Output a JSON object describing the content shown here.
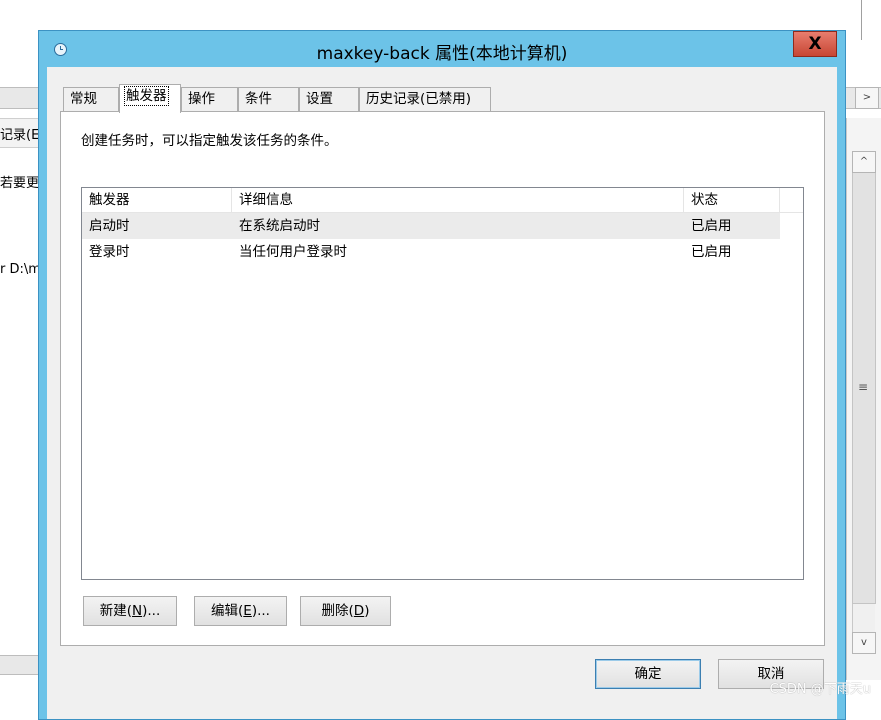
{
  "background": {
    "fragments": [
      "记录(E",
      "若要更",
      "r D:\\m"
    ],
    "scroll_right_label": ">",
    "scroll_up": "^",
    "scroll_down": "v",
    "scroll_grip": "≡"
  },
  "dialog": {
    "title": "maxkey-back 属性(本地计算机)",
    "close_label": "X",
    "tabs": [
      "常规",
      "触发器",
      "操作",
      "条件",
      "设置",
      "历史记录(已禁用)"
    ],
    "active_tab": "触发器",
    "description": "创建任务时，可以指定触发该任务的条件。",
    "columns": [
      "触发器",
      "详细信息",
      "状态"
    ],
    "rows": [
      {
        "trigger": "启动时",
        "details": "在系统启动时",
        "status": "已启用"
      },
      {
        "trigger": "登录时",
        "details": "当任何用户登录时",
        "status": "已启用"
      }
    ],
    "buttons": {
      "new": {
        "text": "新建(",
        "key": "N",
        "tail": ")..."
      },
      "edit": {
        "text": "编辑(",
        "key": "E",
        "tail": ")..."
      },
      "delete": {
        "text": "删除(",
        "key": "D",
        "tail": ")"
      },
      "ok": "确定",
      "cancel": "取消"
    }
  },
  "watermark": "CSDN @下雨天u"
}
